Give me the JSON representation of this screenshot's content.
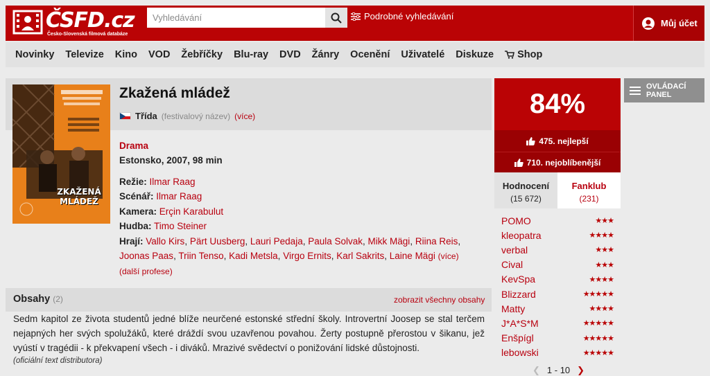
{
  "header": {
    "logo_text": "ČSFD.cz",
    "logo_sub": "Česko-Slovenská filmová databáze",
    "search_placeholder": "Vyhledávání",
    "advanced_search": "Podrobné vyhledávání",
    "account": "Můj účet"
  },
  "nav": {
    "items": [
      "Novinky",
      "Televize",
      "Kino",
      "VOD",
      "Žebříčky",
      "Blu-ray",
      "DVD",
      "Žánry",
      "Ocenění",
      "Uživatelé",
      "Diskuze"
    ],
    "shop": "Shop"
  },
  "film": {
    "title": "Zkažená mládež",
    "alt_title": "Třída",
    "alt_title_note": "(festivalový název)",
    "more": "(více)",
    "genre": "Drama",
    "origin": "Estonsko, 2007, 98 min",
    "poster_title_line1": "ZKAŽENÁ",
    "poster_title_line2": "MLÁDEŽ",
    "director_label": "Režie:",
    "director": "Ilmar Raag",
    "writer_label": "Scénář:",
    "writer": "Ilmar Raag",
    "camera_label": "Kamera:",
    "camera": "Erçin Karabulut",
    "music_label": "Hudba:",
    "music": "Timo Steiner",
    "cast_label": "Hrají:",
    "cast": [
      "Vallo Kirs",
      "Pärt Uusberg",
      "Lauri Pedaja",
      "Paula Solvak",
      "Mikk Mägi",
      "Riina Reis",
      "Joonas Paas",
      "Triin Tenso",
      "Kadi Metsla",
      "Virgo Ernits",
      "Karl Sakrits",
      "Laine Mägi"
    ],
    "cast_more": "(více)",
    "more_professions": "(další profese)"
  },
  "plot": {
    "title": "Obsahy",
    "count": "(2)",
    "show_all": "zobrazit všechny obsahy",
    "text": "Sedm kapitol ze života studentů jedné blíže neurčené estonské střední školy. Introvertní Joosep se stal terčem nejapných her svých spolužáků, které dráždí svou uzavřenou povahou. Žerty postupně přerostou v šikanu, jež vyústí v tragédii - k překvapení všech - i diváků. Mrazivé svědectví o ponižování lidské důstojnosti.",
    "source": "(oficiální text distributora)"
  },
  "rating": {
    "percent": "84%",
    "rank_best": "475. nejlepší",
    "rank_fav": "710. nejoblíbenější",
    "tab_ratings": "Hodnocení",
    "tab_ratings_count": "(15 672)",
    "tab_fanclub": "Fanklub",
    "tab_fanclub_count": "(231)",
    "users": [
      {
        "name": "POMO",
        "stars": "★★★"
      },
      {
        "name": "kleopatra",
        "stars": "★★★★"
      },
      {
        "name": "verbal",
        "stars": "★★★"
      },
      {
        "name": "Cival",
        "stars": "★★★"
      },
      {
        "name": "KevSpa",
        "stars": "★★★★"
      },
      {
        "name": "Blizzard",
        "stars": "★★★★★"
      },
      {
        "name": "Matty",
        "stars": "★★★★"
      },
      {
        "name": "J*A*S*M",
        "stars": "★★★★★"
      },
      {
        "name": "Enšpígl",
        "stars": "★★★★★"
      },
      {
        "name": "lebowski",
        "stars": "★★★★★"
      }
    ],
    "pager": "1 - 10"
  },
  "control_panel": {
    "line1": "OVLÁDACÍ",
    "line2": "PANEL"
  },
  "colors": {
    "brand_red": "#ba0305",
    "dark_red": "#9a0103",
    "link_red": "#b8000f"
  }
}
